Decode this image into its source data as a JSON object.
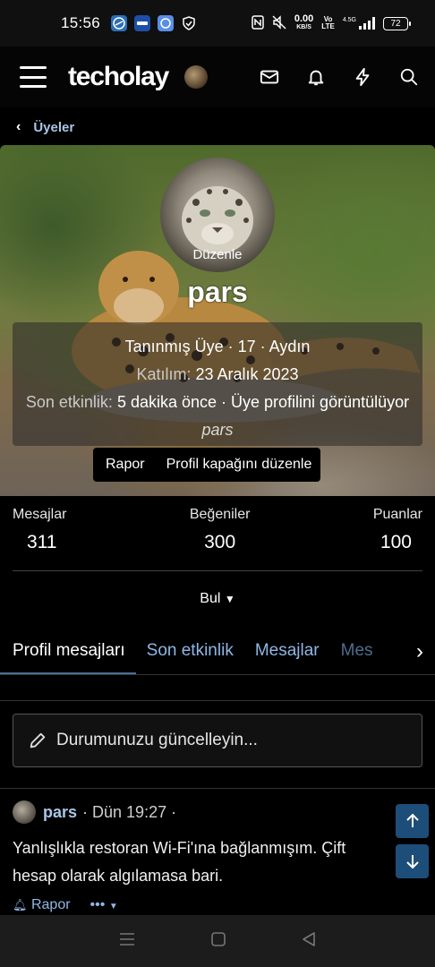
{
  "status_bar": {
    "time": "15:56",
    "app_icons": [
      "ml",
      "mavi",
      "msg",
      "shield"
    ],
    "net_speed_value": "0.00",
    "net_speed_unit": "KB/S",
    "signal": "4.5G",
    "volte_top": "Vo",
    "volte_bottom": "LTE",
    "battery": "72"
  },
  "header": {
    "logo": "techolay",
    "icons": [
      "mail-icon",
      "bell-icon",
      "bolt-icon",
      "search-icon"
    ]
  },
  "breadcrumb": {
    "label": "Üyeler"
  },
  "profile": {
    "edit_label": "Düzenle",
    "username": "pars",
    "title_line": "Tanınmış Üye · 17 · Aydın",
    "joined_label": "Katılım:",
    "joined_value": "23 Aralık 2023",
    "activity_label": "Son etkinlik:",
    "activity_value": "5 dakika önce · Üye profilini görüntülüyor",
    "activity_target": "pars",
    "report_button": "Rapor",
    "edit_cover_button": "Profil kapağını düzenle"
  },
  "stats": {
    "messages_label": "Mesajlar",
    "messages_value": "311",
    "likes_label": "Beğeniler",
    "likes_value": "300",
    "points_label": "Puanlar",
    "points_value": "100"
  },
  "find": {
    "label": "Bul"
  },
  "tabs": [
    {
      "label": "Profil mesajları",
      "active": true
    },
    {
      "label": "Son etkinlik",
      "active": false
    },
    {
      "label": "Mesajlar",
      "active": false
    },
    {
      "label": "Mes",
      "active": false
    }
  ],
  "status_update": {
    "placeholder": "Durumunuzu güncelleyin..."
  },
  "message": {
    "author": "pars",
    "time": "· Dün 19:27 ·",
    "body": "Yanlışlıkla restoran Wi-Fi'ına bağlanmışım. Çift hesap olarak algılamasa bari.",
    "report_label": "Rapor",
    "more_label": "•••"
  },
  "colors": {
    "link": "#8fb7e6",
    "accent": "#1d4e7a",
    "background": "#000000"
  }
}
